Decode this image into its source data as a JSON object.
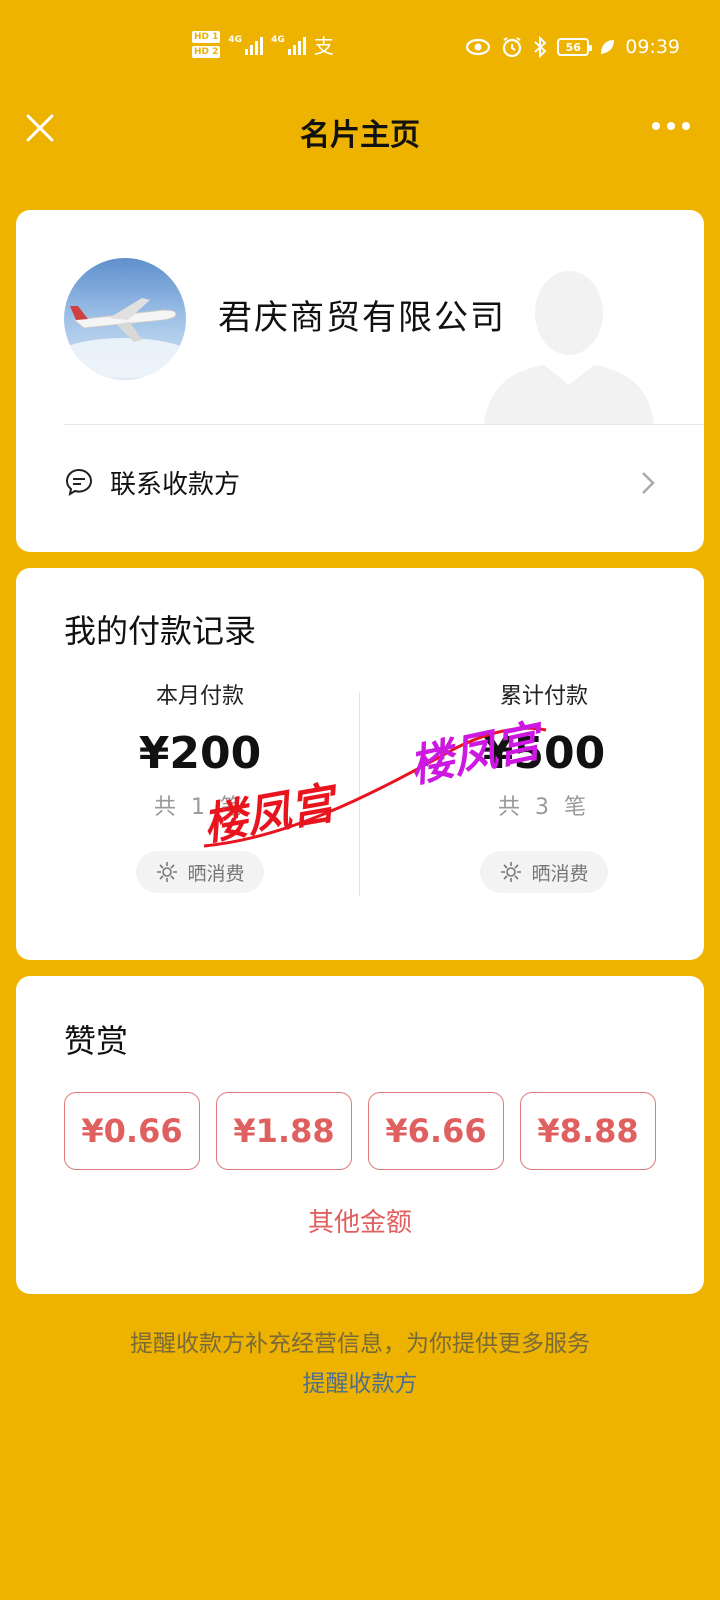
{
  "status_bar": {
    "sim1": "HD 1",
    "sim2": "HD 2",
    "net1": "4G",
    "net2": "4G",
    "battery": "56",
    "time": "09:39"
  },
  "nav": {
    "title": "名片主页"
  },
  "profile": {
    "company_name": "君庆商贸有限公司",
    "contact_label": "联系收款方"
  },
  "payments": {
    "title": "我的付款记录",
    "month": {
      "label": "本月付款",
      "amount": "¥200",
      "count": "共 1 笔",
      "share_label": "晒消费"
    },
    "total": {
      "label": "累计付款",
      "amount": "¥500",
      "count": "共 3 笔",
      "share_label": "晒消费"
    },
    "watermark_text": "楼凤宫"
  },
  "reward": {
    "title": "赞赏",
    "amounts": [
      "¥0.66",
      "¥1.88",
      "¥6.66",
      "¥8.88"
    ],
    "other_label": "其他金额"
  },
  "footer": {
    "text": "提醒收款方补充经营信息，为你提供更多服务",
    "link": "提醒收款方"
  },
  "colors": {
    "background": "#EDB300",
    "accent_red": "#E06060",
    "link_blue": "#4E6F8F"
  }
}
